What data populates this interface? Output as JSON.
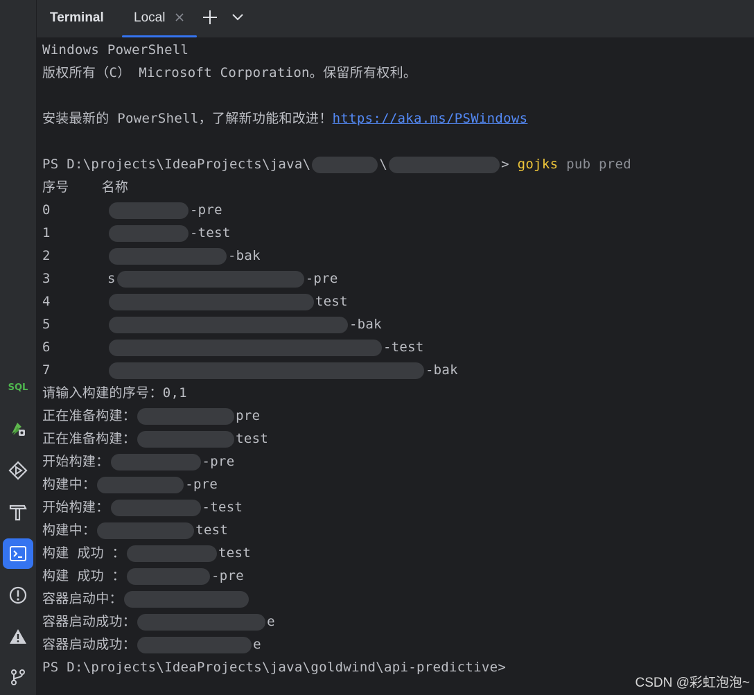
{
  "tool_window": {
    "title": "Terminal",
    "tabs": [
      {
        "label": "Local",
        "active": true
      }
    ],
    "add_tab": "+",
    "accent_color": "#3574f0"
  },
  "sidebar": {
    "items": [
      {
        "name": "sql-icon",
        "label": "SQL"
      },
      {
        "name": "rocket-icon"
      },
      {
        "name": "run-services-icon"
      },
      {
        "name": "build-icon"
      },
      {
        "name": "terminal-icon",
        "active": true
      },
      {
        "name": "problems-icon"
      },
      {
        "name": "warning-icon"
      },
      {
        "name": "git-icon"
      }
    ]
  },
  "terminal": {
    "header": "Windows PowerShell",
    "copyright": "版权所有（C） Microsoft Corporation。保留所有权利。",
    "install_prefix": "安装最新的 PowerShell，了解新功能和改进！",
    "install_link": "https://aka.ms/PSWindows",
    "prompt_prefix": "PS D:\\projects\\IdeaProjects\\java\\",
    "prompt_mid": "\\",
    "prompt_end": ">",
    "command": "gojks",
    "command_args": "pub pred",
    "table_header": {
      "num": "序号",
      "name": "名称"
    },
    "projects": [
      {
        "num": "0",
        "prefix": "",
        "suffix": "-pre"
      },
      {
        "num": "1",
        "prefix": "",
        "suffix": "-test"
      },
      {
        "num": "2",
        "prefix": "",
        "suffix": "-bak"
      },
      {
        "num": "3",
        "prefix": "s",
        "suffix": "-pre"
      },
      {
        "num": "4",
        "prefix": "",
        "suffix": "test"
      },
      {
        "num": "5",
        "prefix": "",
        "suffix": "-bak"
      },
      {
        "num": "6",
        "prefix": "",
        "suffix": "-test"
      },
      {
        "num": "7",
        "prefix": "",
        "suffix": "-bak"
      }
    ],
    "input_prompt": "请输入构建的序号：",
    "input_value": "0,1",
    "log": [
      {
        "label": "正在准备构建：",
        "suffix": "pre"
      },
      {
        "label": "正在准备构建：",
        "suffix": "test"
      },
      {
        "label": "开始构建：",
        "suffix": "-pre"
      },
      {
        "label": "构建中：",
        "suffix": "-pre"
      },
      {
        "label": "开始构建：",
        "suffix": "-test"
      },
      {
        "label": "构建中：",
        "suffix": "test"
      },
      {
        "label": "构建 成功 ：",
        "suffix": "test"
      },
      {
        "label": "构建 成功 ：",
        "suffix": "-pre"
      },
      {
        "label": "容器启动中：",
        "suffix": ""
      },
      {
        "label": "容器启动成功：",
        "suffix": "e"
      },
      {
        "label": "容器启动成功：",
        "suffix": "e"
      }
    ],
    "final_prompt": "PS D:\\projects\\IdeaProjects\\java\\goldwind\\api-predictive>"
  },
  "watermark": "CSDN @彩虹泡泡~"
}
